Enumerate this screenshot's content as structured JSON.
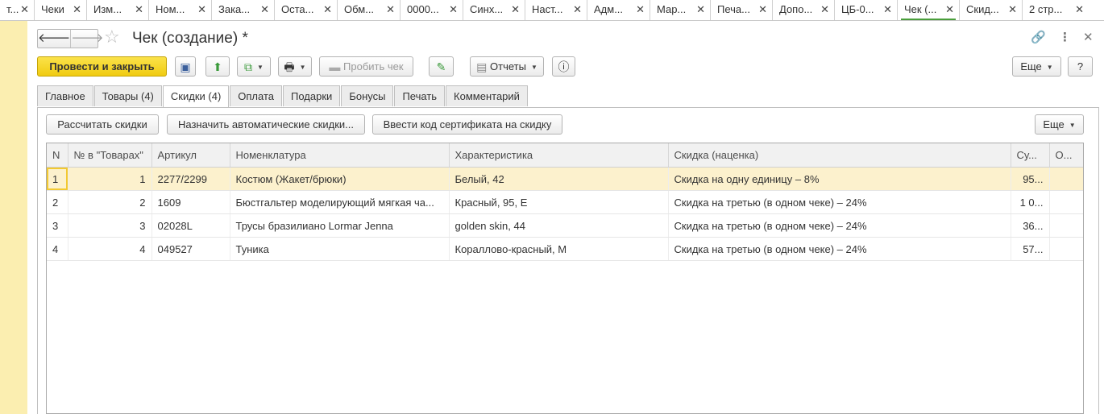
{
  "tabs": [
    {
      "label": "т..."
    },
    {
      "label": "Чеки"
    },
    {
      "label": "Изм..."
    },
    {
      "label": "Ном..."
    },
    {
      "label": "Зака..."
    },
    {
      "label": "Оста..."
    },
    {
      "label": "Обм..."
    },
    {
      "label": "0000..."
    },
    {
      "label": "Синх..."
    },
    {
      "label": "Наст..."
    },
    {
      "label": "Адм..."
    },
    {
      "label": "Мар..."
    },
    {
      "label": "Печа..."
    },
    {
      "label": "Допо..."
    },
    {
      "label": "ЦБ-0..."
    },
    {
      "label": "Чек (..."
    },
    {
      "label": "Скид..."
    },
    {
      "label": "2 стр..."
    }
  ],
  "header": {
    "title": "Чек (создание) *"
  },
  "toolbar": {
    "post_close": "Провести и закрыть",
    "print_check": "Пробить чек",
    "reports": "Отчеты",
    "more": "Еще",
    "help": "?"
  },
  "page_tabs": [
    "Главное",
    "Товары (4)",
    "Скидки (4)",
    "Оплата",
    "Подарки",
    "Бонусы",
    "Печать",
    "Комментарий"
  ],
  "discount_toolbar": {
    "calc": "Рассчитать скидки",
    "assign_auto": "Назначить автоматические скидки...",
    "enter_code": "Ввести код сертификата на скидку",
    "more": "Еще"
  },
  "table": {
    "columns": [
      "N",
      "№ в \"Товарах\"",
      "Артикул",
      "Номенклатура",
      "Характеристика",
      "Скидка (наценка)",
      "Су...",
      "О..."
    ],
    "rows": [
      [
        "1",
        "1",
        "2277/2299",
        "Костюм (Жакет/брюки)",
        "Белый, 42",
        "Скидка на одну единицу – 8%",
        "95...",
        ""
      ],
      [
        "2",
        "2",
        "1609",
        "Бюстгальтер моделирующий мягкая ча...",
        "Красный, 95, E",
        "Скидка  на третью (в одном чеке) – 24%",
        "1 0...",
        ""
      ],
      [
        "3",
        "3",
        "02028L",
        "Трусы бразилиано Lormar Jenna",
        "golden skin, 44",
        "Скидка  на третью (в одном чеке) – 24%",
        "36...",
        ""
      ],
      [
        "4",
        "4",
        "049527",
        "Туника",
        "Кораллово-красный, M",
        "Скидка  на третью (в одном чеке) – 24%",
        "57...",
        ""
      ]
    ]
  }
}
